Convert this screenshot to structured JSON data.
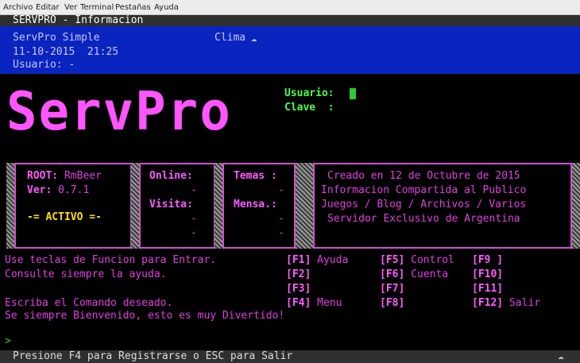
{
  "menu": [
    "Archivo",
    "Editar",
    "Ver",
    "Terminal",
    "Pestañas",
    "Ayuda"
  ],
  "title": "SERVPRO - Informacion",
  "header": {
    "app": "ServPro Simple",
    "clima_label": "Clima",
    "datetime": "11-10-2015  21:25",
    "usuario": "Usuario: -"
  },
  "logo": "ServPro",
  "login": {
    "usuario_label": "Usuario:",
    "clave_label": "Clave  :"
  },
  "panel_root": {
    "root_label": "ROOT:",
    "root_value": "RmBeer",
    "ver_label": "Ver:",
    "ver_value": "0.7.1",
    "status": "-= ACTIVO =-"
  },
  "panel_online": {
    "online_label": "Online:",
    "online_value": "-",
    "visita_label": "Visita:",
    "visita_value": "-",
    "extra_value": "-"
  },
  "panel_temas": {
    "temas_label": "Temas :",
    "temas_value": "-",
    "mensa_label": "Mensa.:",
    "mensa_value": "-",
    "extra_value": "-"
  },
  "panel_info": {
    "line1": "Creado en 12 de Octubre de 2015",
    "line2": "Informacion Compartida al Publico",
    "line3": "Juegos / Blog / Archivos / Varios",
    "line4": "Servidor Exclusivo de Argentina"
  },
  "help": {
    "line1": "Use teclas de Funcion para Entrar.",
    "line2": "Consulte siempre la ayuda.",
    "line3": "Escriba el Comando deseado.",
    "line4": "Se siempre Bienvenido, esto es muy Divertido!"
  },
  "fkeys": {
    "f1": "[F1]",
    "f1_label": "Ayuda",
    "f2": "[F2]",
    "f3": "[F3]",
    "f4": "[F4]",
    "f4_label": "Menu",
    "f5": "[F5]",
    "f5_label": "Control",
    "f6": "[F6]",
    "f6_label": "Cuenta",
    "f7": "[F7]",
    "f8": "[F8]",
    "f9": "[F9 ]",
    "f10": "[F10]",
    "f11": "[F11]",
    "f12": "[F12]",
    "f12_label": "Salir"
  },
  "prompt": ">",
  "status": "Presione F4 para Registrarse o ESC para Salir",
  "colors": {
    "magenta": "#e040e0",
    "blue_header": "#0a24c0",
    "green": "#28d028"
  }
}
